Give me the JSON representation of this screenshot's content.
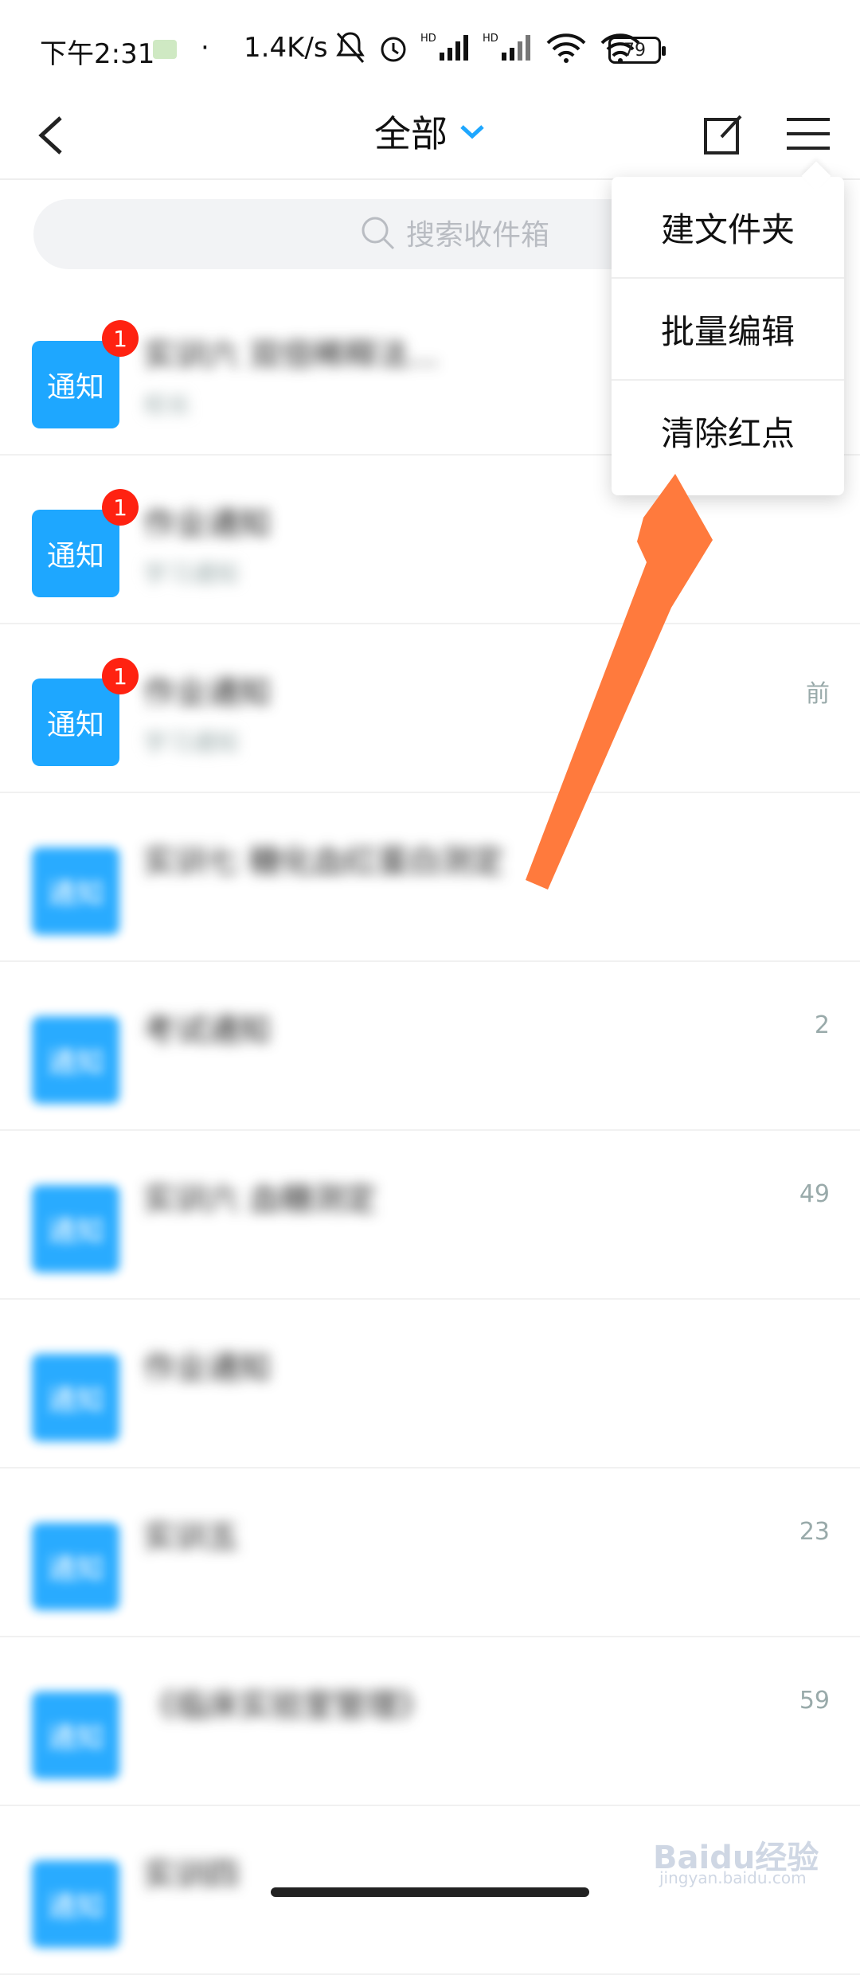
{
  "status": {
    "time": "下午2:31",
    "dot": "·",
    "speed": "1.4K/s",
    "battery": "79"
  },
  "header": {
    "title": "全部",
    "back_icon": "chevron-left-icon",
    "dropdown_icon": "chevron-down-icon",
    "edit_icon": "edit-icon",
    "menu_icon": "menu-icon"
  },
  "search": {
    "placeholder": "搜索收件箱",
    "icon": "search-icon"
  },
  "dropdown_menu": {
    "items": [
      "建文件夹",
      "批量编辑",
      "清除红点"
    ]
  },
  "list": {
    "items": [
      {
        "avatar": "通知",
        "badge": "1",
        "title": "实训六 双倍稀释法...",
        "sub": "校长"
      },
      {
        "avatar": "通知",
        "badge": "1",
        "title": "作业通知",
        "sub": "学习通知"
      },
      {
        "avatar": "通知",
        "badge": "1",
        "title": "作业通知",
        "sub": "学习通知",
        "time": "前"
      },
      {
        "avatar": "通知",
        "title": "实训七 糖化血红蛋白测定",
        "sub": "",
        "time": ""
      },
      {
        "avatar": "通知",
        "title": "考试通知",
        "sub": "",
        "time": "2"
      },
      {
        "avatar": "通知",
        "title": "实训六 血糖测定",
        "sub": "",
        "time": "49"
      },
      {
        "avatar": "通知",
        "title": "作业通知",
        "sub": "",
        "time": ""
      },
      {
        "avatar": "通知",
        "title": "实训五",
        "sub": "",
        "time": "23"
      },
      {
        "avatar": "通知",
        "title": "《临床实验室管理》",
        "sub": "",
        "time": "59"
      },
      {
        "avatar": "通知",
        "title": "实训四",
        "sub": "",
        "time": ""
      }
    ]
  },
  "watermark": {
    "text": "Baidu经验",
    "sub": "jingyan.baidu.com"
  },
  "colors": {
    "accent": "#1ea7ff",
    "badge": "#ff2211",
    "arrow": "#ff7a3d"
  }
}
